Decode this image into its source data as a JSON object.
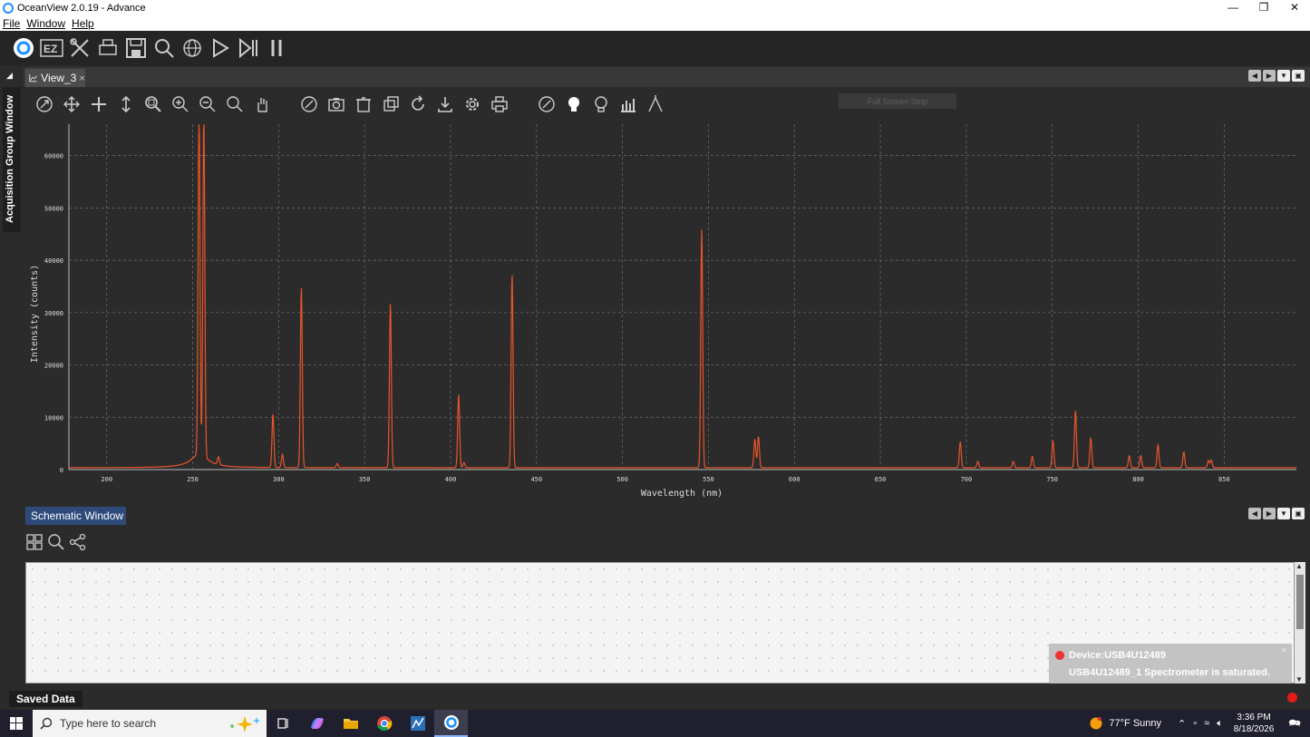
{
  "window": {
    "title": "OceanView 2.0.19 - Advance"
  },
  "menu": {
    "items": [
      "File",
      "Window",
      "Help"
    ]
  },
  "side": {
    "tab_label": "Acquisition Group Window"
  },
  "view": {
    "tab_label": "View_3",
    "fullscreen_label": "Full Screen Strip"
  },
  "schematic": {
    "tab_label": "Schematic Window"
  },
  "notification": {
    "title": "Device:USB4U12489",
    "message": "USB4U12489_1 Spectrometer is saturated."
  },
  "status": {
    "saved_label": "Saved Data"
  },
  "taskbar": {
    "search_placeholder": "Type here to search",
    "weather": "77°F  Sunny",
    "time": "3:36 PM",
    "date": "8/18/2026"
  },
  "colors": {
    "trace": "#e8552b",
    "background": "#2b2b2b",
    "grid": "#707070"
  },
  "chart_data": {
    "type": "line",
    "title": "",
    "xlabel": "Wavelength (nm)",
    "ylabel": "Intensity (counts)",
    "xlim": [
      178,
      892
    ],
    "ylim": [
      0,
      66000
    ],
    "xticks": [
      200,
      250,
      300,
      350,
      400,
      450,
      500,
      550,
      600,
      650,
      700,
      750,
      800,
      850
    ],
    "yticks": [
      0,
      10000,
      20000,
      30000,
      40000,
      50000,
      60000
    ],
    "grid": true,
    "series": [
      {
        "peaks": [
          {
            "x": 253.7,
            "y": 66000
          },
          {
            "x": 256.5,
            "y": 66000
          },
          {
            "x": 265.0,
            "y": 1500
          },
          {
            "x": 296.7,
            "y": 10200
          },
          {
            "x": 302.2,
            "y": 2500
          },
          {
            "x": 313.2,
            "y": 34500
          },
          {
            "x": 334.1,
            "y": 800
          },
          {
            "x": 365.0,
            "y": 31500
          },
          {
            "x": 404.7,
            "y": 14000
          },
          {
            "x": 407.8,
            "y": 1000
          },
          {
            "x": 435.8,
            "y": 37000
          },
          {
            "x": 546.1,
            "y": 45500
          },
          {
            "x": 577.0,
            "y": 5500
          },
          {
            "x": 579.1,
            "y": 6000
          },
          {
            "x": 696.5,
            "y": 5000
          },
          {
            "x": 706.7,
            "y": 1200
          },
          {
            "x": 727.3,
            "y": 1200
          },
          {
            "x": 738.4,
            "y": 2200
          },
          {
            "x": 750.4,
            "y": 5200
          },
          {
            "x": 763.5,
            "y": 11000
          },
          {
            "x": 772.4,
            "y": 5700
          },
          {
            "x": 794.8,
            "y": 2300
          },
          {
            "x": 801.5,
            "y": 2300
          },
          {
            "x": 811.5,
            "y": 4400
          },
          {
            "x": 826.5,
            "y": 3000
          },
          {
            "x": 840.8,
            "y": 1400
          },
          {
            "x": 842.5,
            "y": 1500
          }
        ]
      }
    ]
  }
}
